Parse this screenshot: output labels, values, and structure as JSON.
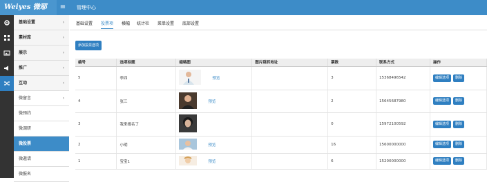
{
  "header": {
    "logo": "Weiyes 微耶",
    "menu_toggle": "≡",
    "tab": "管理中心"
  },
  "sidebar": {
    "icons": [
      "gear-icon",
      "grid-icon",
      "image-icon",
      "megaphone-icon",
      "shuffle-icon"
    ],
    "sections": [
      {
        "label": "基础设置",
        "chev": "›"
      },
      {
        "label": "素材库",
        "chev": "›"
      },
      {
        "label": "展示",
        "chev": "›"
      },
      {
        "label": "推广",
        "chev": "›"
      },
      {
        "label": "互动",
        "chev": "‹"
      }
    ],
    "subitems": [
      {
        "label": "微留言",
        "chev": "›"
      },
      {
        "label": "微预约"
      },
      {
        "label": "微调研"
      },
      {
        "label": "微投票"
      },
      {
        "label": "微邀请"
      },
      {
        "label": "微报名"
      }
    ]
  },
  "subnav": [
    "基础设置",
    "投票项",
    "横幅",
    "统计栏",
    "菜单设置",
    "底部设置"
  ],
  "actions": {
    "add": "添加投票选项"
  },
  "table": {
    "headers": [
      "编号",
      "选项标题",
      "缩略图",
      "图片跳转地址",
      "票数",
      "联系方式",
      "操作"
    ],
    "rows": [
      {
        "id": "5",
        "title": "李四",
        "preview": "预览",
        "url": "",
        "votes": "3",
        "contact": "15368496542",
        "edit": "编辑选项",
        "del": "删除"
      },
      {
        "id": "4",
        "title": "张三",
        "preview": "预览",
        "url": "",
        "votes": "2",
        "contact": "15645687980",
        "edit": "编辑选项",
        "del": "删除"
      },
      {
        "id": "3",
        "title": "我来报名了",
        "preview": "",
        "url": "",
        "votes": "0",
        "contact": "15972100592",
        "edit": "编辑选项",
        "del": "删除"
      },
      {
        "id": "2",
        "title": "小明",
        "preview": "预览",
        "url": "",
        "votes": "16",
        "contact": "15600000000",
        "edit": "编辑选项",
        "del": "删除"
      },
      {
        "id": "1",
        "title": "宝宝1",
        "preview": "预览",
        "url": "",
        "votes": "6",
        "contact": "15200000000",
        "edit": "编辑选项",
        "del": "删除"
      }
    ]
  },
  "colors": {
    "primary": "#3d8cc8",
    "button": "#2f7fc1",
    "rail": "#333333"
  }
}
